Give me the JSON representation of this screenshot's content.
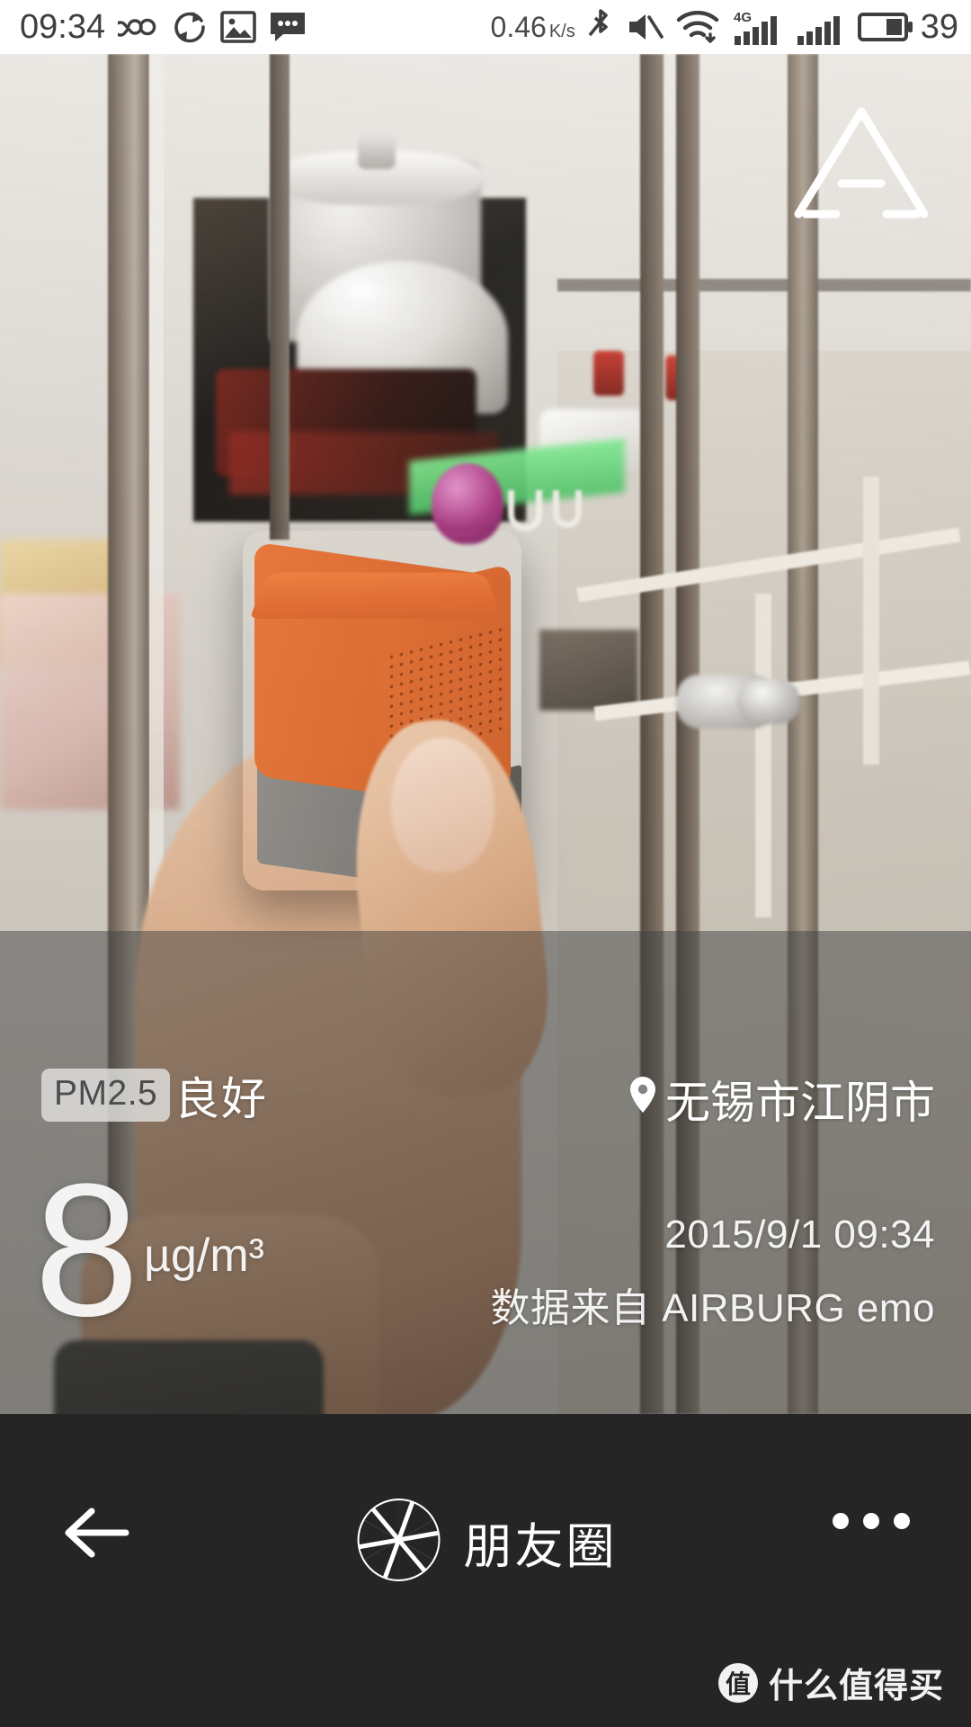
{
  "statusbar": {
    "time": "09:34",
    "network_speed": "0.46",
    "network_speed_unit": "K/s",
    "battery_percent": "39",
    "icons": [
      "infinity-icon",
      "sync-icon",
      "gallery-icon",
      "message-icon",
      "bluetooth-icon",
      "mute-icon",
      "wifi-icon",
      "signal-4g-icon",
      "signal-bars-icon",
      "battery-icon"
    ],
    "network_type": "4G"
  },
  "photo": {
    "alt_label": "orange AIRBURG emo air quality cube held in hand in front of kitchen window",
    "logo_name": "airburg-triangle-logo"
  },
  "overlay": {
    "pm_badge": "PM2.5",
    "pm_level": "良好",
    "location_icon": "location-pin-icon",
    "location": "无锡市江阴市",
    "value": "8",
    "unit": "µg/m³",
    "timestamp": "2015/9/1 09:34",
    "source": "数据来自 AIRBURG emo"
  },
  "bottombar": {
    "back_icon": "back-arrow-icon",
    "share_icon": "camera-shutter-icon",
    "share_label": "朋友圈",
    "more_icon": "more-dots-icon"
  },
  "watermark": {
    "mark": "值",
    "text": "什么值得买"
  },
  "colors": {
    "accent_orange": "#e06a2c",
    "bottom_bar": "#252526",
    "status_bar_bg": "#ffffff",
    "status_bar_fg": "#3f3f3f",
    "overlay_scrim": "rgba(60,62,62,0.48)"
  }
}
